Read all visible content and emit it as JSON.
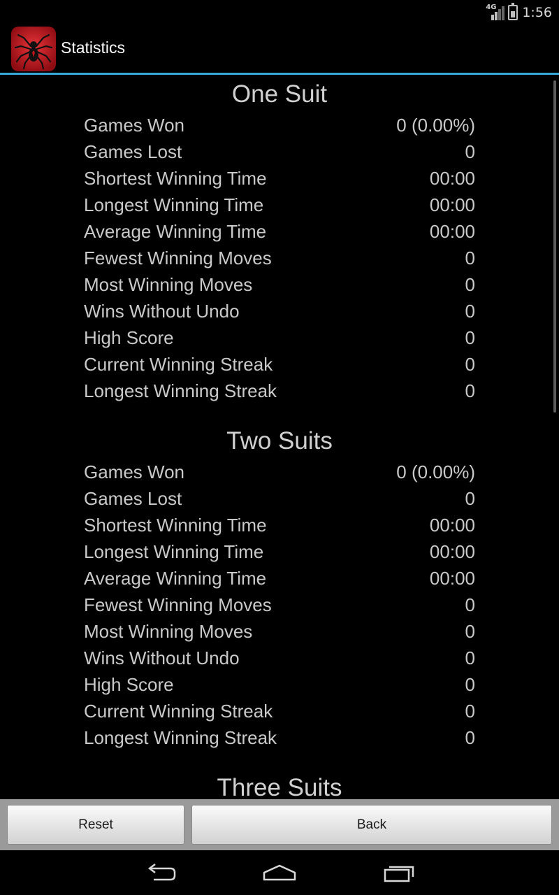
{
  "status_bar": {
    "network": "4G",
    "time": "1:56"
  },
  "app_bar": {
    "title": "Statistics"
  },
  "sections": [
    {
      "title": "One Suit",
      "rows": [
        {
          "label": "Games Won",
          "value": "0 (0.00%)"
        },
        {
          "label": "Games Lost",
          "value": "0"
        },
        {
          "label": "Shortest Winning Time",
          "value": "00:00"
        },
        {
          "label": "Longest Winning Time",
          "value": "00:00"
        },
        {
          "label": "Average Winning Time",
          "value": "00:00"
        },
        {
          "label": "Fewest Winning Moves",
          "value": "0"
        },
        {
          "label": "Most Winning Moves",
          "value": "0"
        },
        {
          "label": "Wins Without Undo",
          "value": "0"
        },
        {
          "label": "High Score",
          "value": "0"
        },
        {
          "label": "Current Winning Streak",
          "value": "0"
        },
        {
          "label": "Longest Winning Streak",
          "value": "0"
        }
      ]
    },
    {
      "title": "Two Suits",
      "rows": [
        {
          "label": "Games Won",
          "value": "0 (0.00%)"
        },
        {
          "label": "Games Lost",
          "value": "0"
        },
        {
          "label": "Shortest Winning Time",
          "value": "00:00"
        },
        {
          "label": "Longest Winning Time",
          "value": "00:00"
        },
        {
          "label": "Average Winning Time",
          "value": "00:00"
        },
        {
          "label": "Fewest Winning Moves",
          "value": "0"
        },
        {
          "label": "Most Winning Moves",
          "value": "0"
        },
        {
          "label": "Wins Without Undo",
          "value": "0"
        },
        {
          "label": "High Score",
          "value": "0"
        },
        {
          "label": "Current Winning Streak",
          "value": "0"
        },
        {
          "label": "Longest Winning Streak",
          "value": "0"
        }
      ]
    },
    {
      "title": "Three Suits",
      "rows": []
    }
  ],
  "buttons": {
    "reset": "Reset",
    "back": "Back"
  },
  "nav": {
    "back_icon": "back-arrow-icon",
    "home_icon": "home-icon",
    "recents_icon": "recent-apps-icon"
  },
  "colors": {
    "accent": "#38a6d6",
    "background": "#000000",
    "text": "#c9c9c9"
  }
}
